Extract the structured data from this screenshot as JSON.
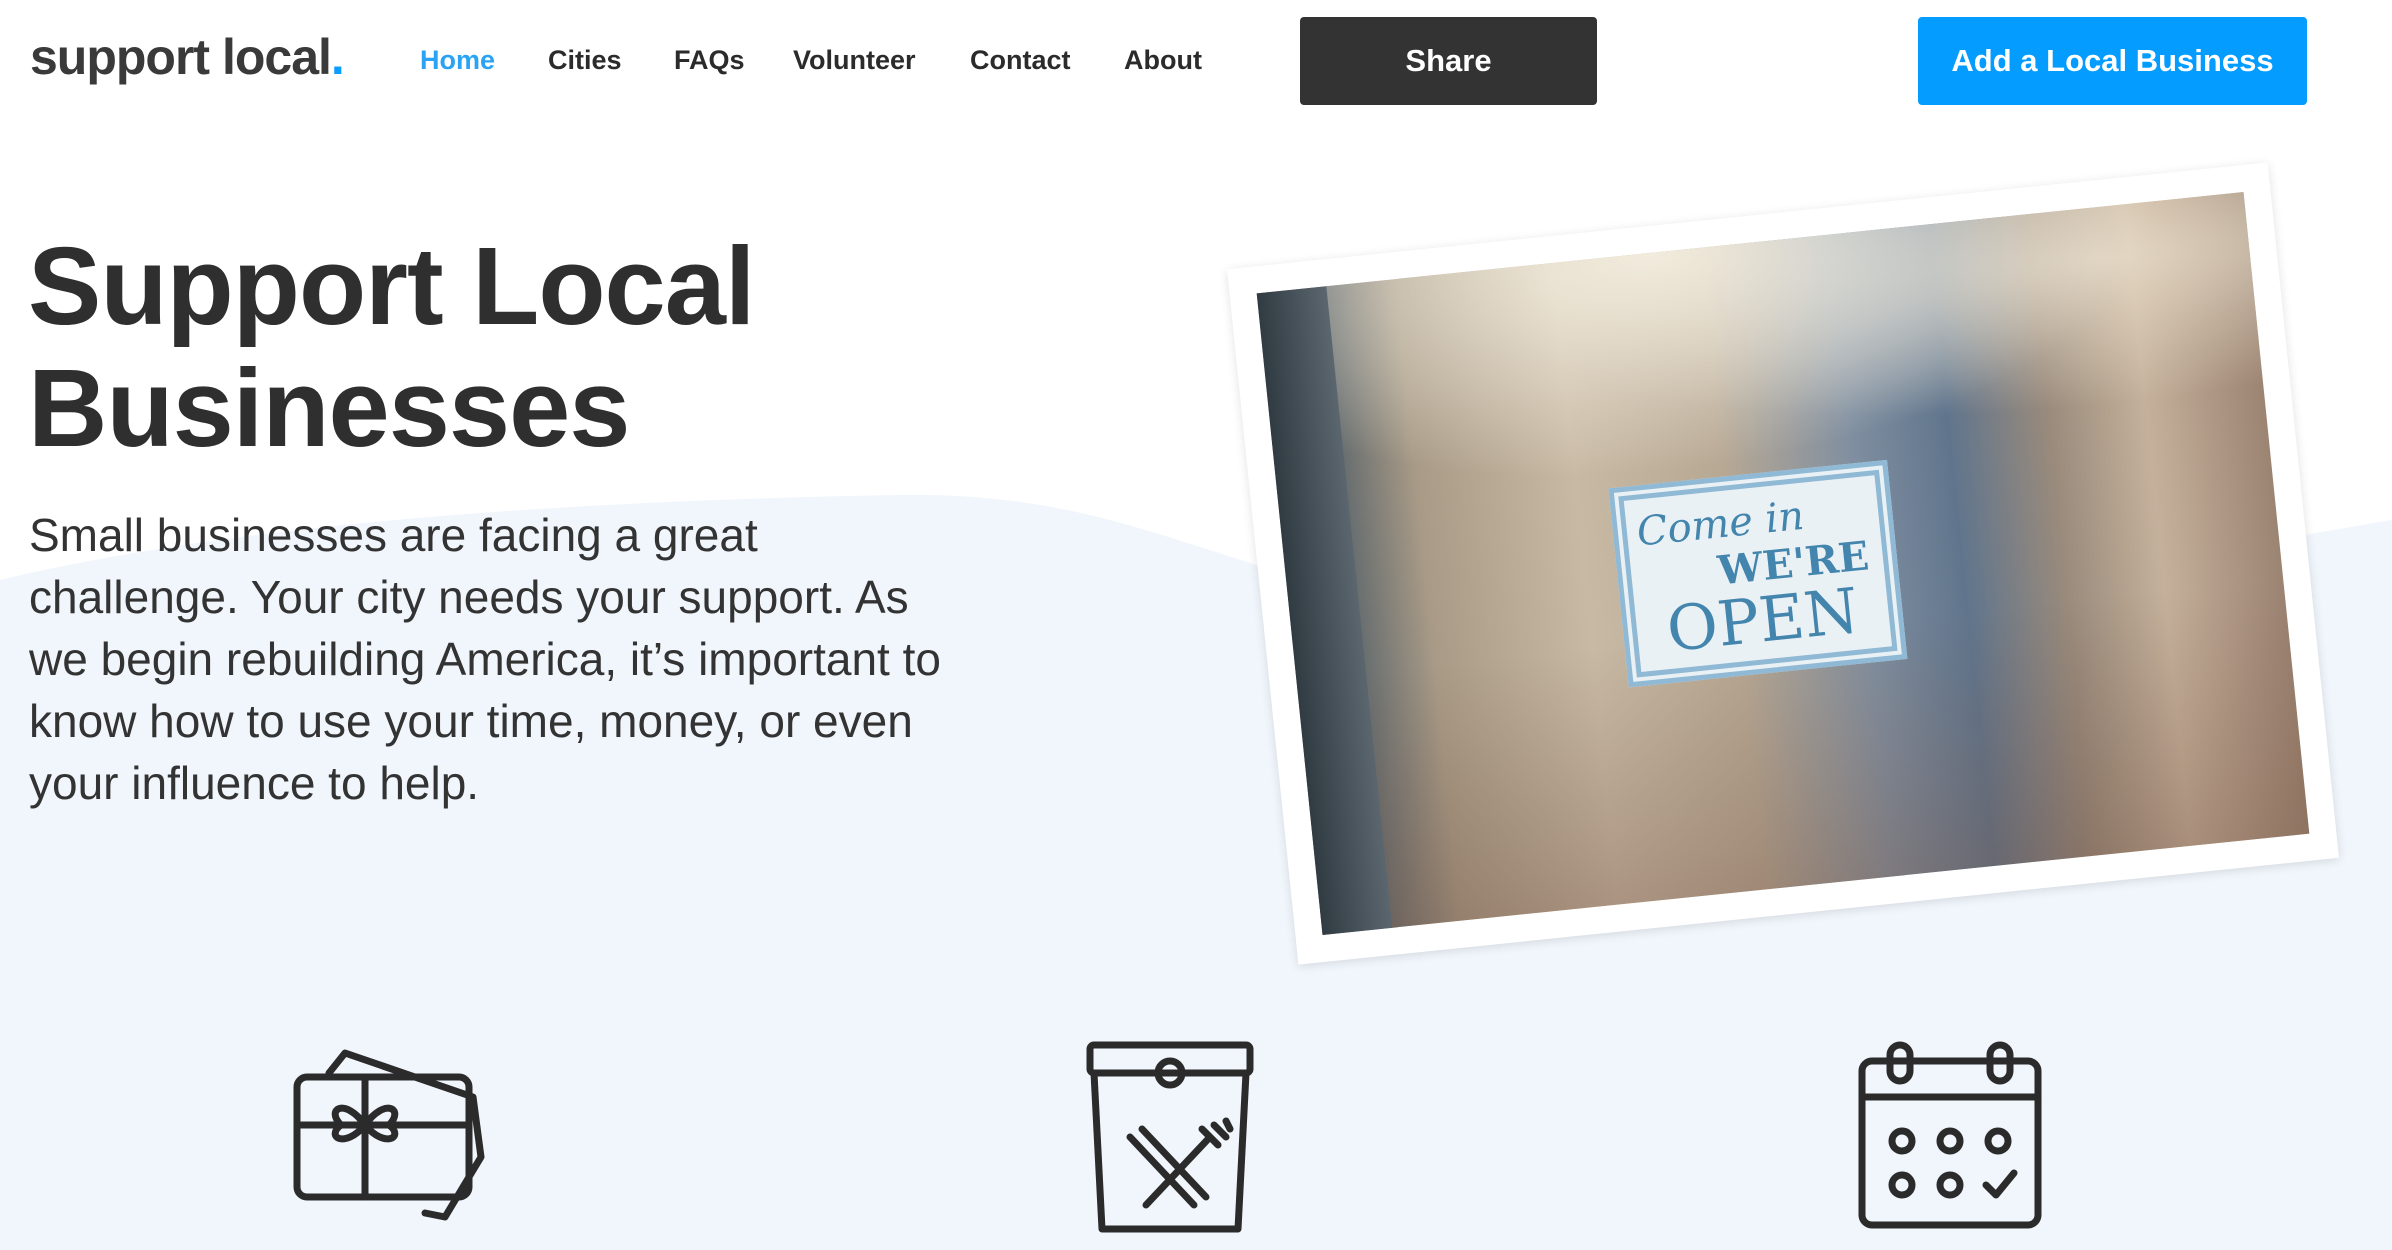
{
  "header": {
    "logo": {
      "text": "support local",
      "dot": ".",
      "dot_color": "#0a9cff"
    },
    "nav": [
      {
        "label": "Home",
        "active": true
      },
      {
        "label": "Cities"
      },
      {
        "label": "FAQs"
      },
      {
        "label": "Volunteer"
      },
      {
        "label": "Contact"
      },
      {
        "label": "About"
      }
    ],
    "share_label": "Share",
    "add_business_label": "Add a Local Business"
  },
  "hero": {
    "title_line1": "Support Local",
    "title_line2": "Businesses",
    "intro": "Small businesses are facing a great challenge. Your city needs your support. As we begin rebuilding America, it’s important to know how to use your time, money, or even your influence to help.",
    "photo_sign": {
      "line1": "Come in",
      "line2": "WE'RE",
      "line3": "OPEN"
    }
  },
  "features": {
    "icons": [
      "gift-card-icon",
      "food-takeout-bag-icon",
      "calendar-icon"
    ]
  },
  "colors": {
    "accent": "#049cff",
    "dark": "#333333",
    "wave": "#f0f6fc"
  }
}
